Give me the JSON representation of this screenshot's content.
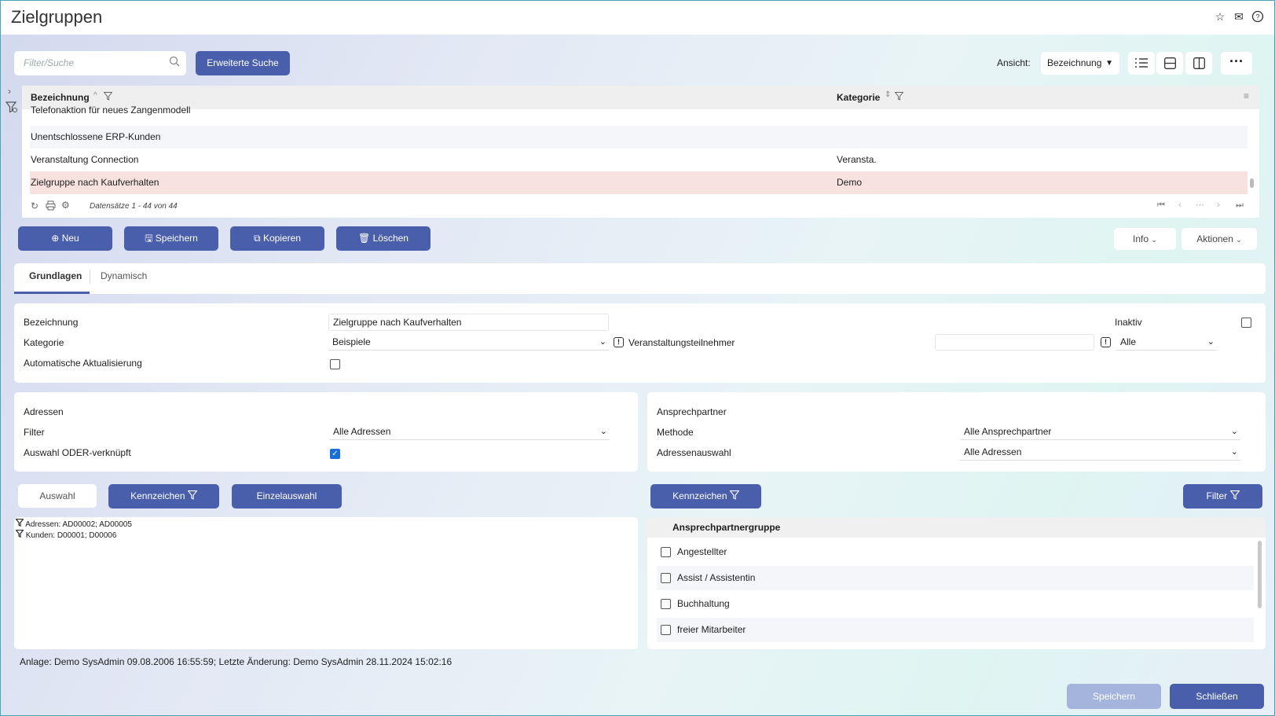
{
  "header": {
    "title": "Zielgruppen"
  },
  "toolbar": {
    "search_placeholder": "Filter/Suche",
    "advanced_search": "Erweiterte Suche",
    "view_label": "Ansicht:",
    "view_value": "Bezeichnung"
  },
  "grid": {
    "columns": [
      "Bezeichnung",
      "Kategorie"
    ],
    "rows": [
      {
        "name": "Telefonaktion für neues Zangenmodell",
        "category": ""
      },
      {
        "name": "Unentschlossene ERP-Kunden",
        "category": ""
      },
      {
        "name": "Veranstaltung Connection",
        "category": "Veransta."
      },
      {
        "name": "Zielgruppe nach Kaufverhalten",
        "category": "Demo"
      }
    ],
    "records": "Datensätze 1 - 44 von 44",
    "pager_more": "···"
  },
  "actions": {
    "new": "Neu",
    "save": "Speichern",
    "copy": "Kopieren",
    "delete": "Löschen",
    "info": "Info",
    "aktionen": "Aktionen"
  },
  "tabs": [
    "Grundlagen",
    "Dynamisch"
  ],
  "form": {
    "bezeichnung_label": "Bezeichnung",
    "bezeichnung_value": "Zielgruppe nach Kaufverhalten",
    "inaktiv_label": "Inaktiv",
    "kategorie_label": "Kategorie",
    "kategorie_value": "Beispiele",
    "veranstaltung_label": "Veranstaltungsteilnehmer",
    "veranstaltung_select": "Alle",
    "auto_label": "Automatische Aktualisierung"
  },
  "adressen": {
    "title": "Adressen",
    "filter_label": "Filter",
    "filter_value": "Alle Adressen",
    "oder_label": "Auswahl ODER-verknüpft"
  },
  "ansprechpartner": {
    "title": "Ansprechpartner",
    "methode_label": "Methode",
    "methode_value": "Alle Ansprechpartner",
    "adressauswahl_label": "Adressenauswahl",
    "adressauswahl_value": "Alle Adressen"
  },
  "selection": {
    "auswahl": "Auswahl",
    "kennzeichen": "Kennzeichen",
    "einzelauswahl": "Einzelauswahl",
    "kennzeichen_right": "Kennzeichen",
    "filter": "Filter",
    "filters": [
      "Adressen: AD00002; AD00005",
      "Kunden: D00001; D00006"
    ]
  },
  "gruppen": {
    "title": "Ansprechpartnergruppe",
    "items": [
      "Angestellter",
      "Assist / Assistentin",
      "Buchhaltung",
      "freier Mitarbeiter"
    ]
  },
  "footer": {
    "info": "Anlage: Demo SysAdmin 09.08.2006 16:55:59; Letzte Änderung: Demo SysAdmin 28.11.2024 15:02:16",
    "save": "Speichern",
    "close": "Schließen"
  }
}
